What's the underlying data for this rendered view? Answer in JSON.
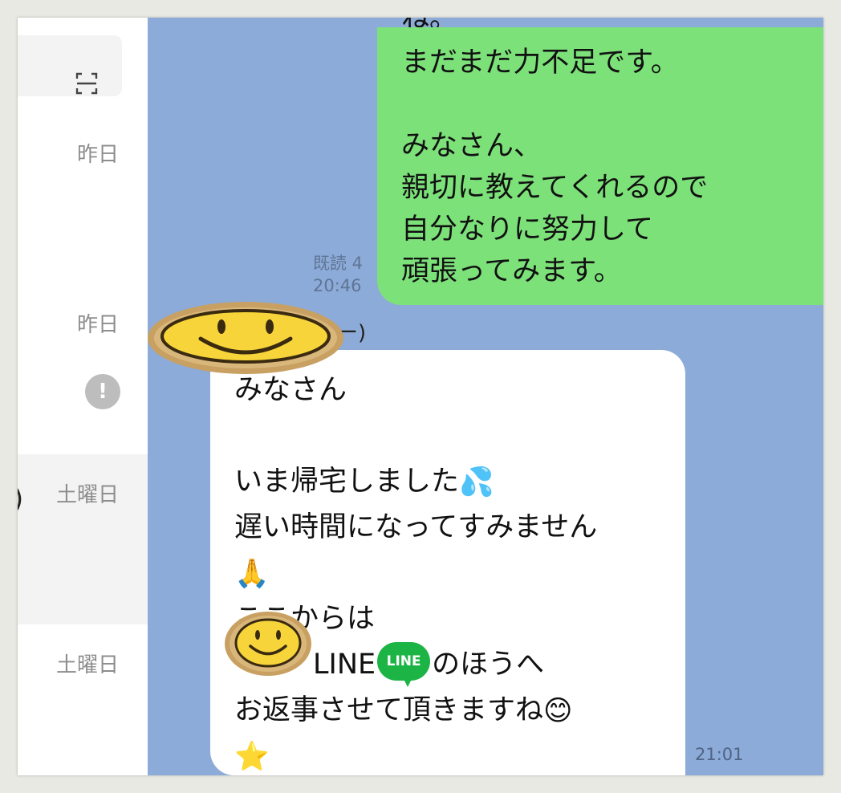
{
  "sidebar": {
    "scan_icon": "qr-scan-icon",
    "dates": [
      "昨日",
      "昨日",
      "土曜日",
      "土曜日"
    ],
    "warning_icon_glyph": "!",
    "edge_glyphs": [
      "›",
      ")"
    ]
  },
  "chat": {
    "background_color": "#8cabd8",
    "outgoing": {
      "clipped_top_text": "ね。",
      "lines": [
        "まだまだ力不足です。",
        "",
        "みなさん、",
        "親切に教えてくれるので",
        "自分なりに努力して",
        "頑張ってみます。"
      ],
      "read_receipt": "既読 4",
      "time": "20:46",
      "color": "#7de17a"
    },
    "sender_name_tail": "ー)",
    "incoming": {
      "lines": {
        "l1": "みなさん",
        "l3": "いま帰宅しました",
        "l4": "遅い時間になってすみません",
        "l6": "ここからは",
        "l7_pre": "LINE",
        "l7_post": "のほうへ",
        "l8": "お返事させて頂きますね"
      },
      "emoji": {
        "sweat": "💦",
        "pray": "🙏",
        "smile": "😊",
        "star": "⭐"
      },
      "line_badge_text": "LINE",
      "time": "21:01"
    },
    "overlays": [
      "smiley-sticker",
      "smiley-sticker-small"
    ]
  }
}
